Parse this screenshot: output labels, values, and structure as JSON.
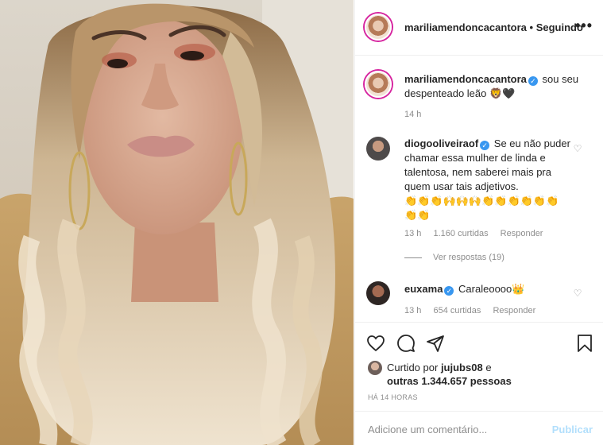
{
  "header": {
    "username": "mariliamendoncacantora",
    "separator": "•",
    "follow_state": "Seguindo",
    "more_icon": "ellipsis-icon",
    "more_label": "•••"
  },
  "caption": {
    "username": "mariliamendoncacantora",
    "text": "sou seu despenteado leão 🦁🖤",
    "time": "14 h"
  },
  "comments": [
    {
      "username": "diogooliveiraof",
      "text": "Se eu não puder chamar essa mulher de linda e talentosa, nem saberei mais pra quem usar tais adjetivos.",
      "emojis": "👏👏👏🙌🙌🙌👏👏👏👏👏👏👏👏",
      "time": "13 h",
      "likes": "1.160 curtidas",
      "reply": "Responder",
      "view_replies": "Ver respostas (19)"
    },
    {
      "username": "euxama",
      "text": "Caraleoooo👑",
      "time": "13 h",
      "likes": "654 curtidas",
      "reply": "Responder"
    }
  ],
  "actions": {
    "like_icon": "heart-icon",
    "comment_icon": "comment-icon",
    "share_icon": "send-icon",
    "save_icon": "bookmark-icon"
  },
  "likes_summary": {
    "prefix": "Curtido por",
    "user": "jujubs08",
    "mid": "e",
    "others": "outras 1.344.657 pessoas"
  },
  "post_age": "HÁ 14 HORAS",
  "comment_box": {
    "placeholder": "Adicione um comentário...",
    "publish": "Publicar"
  },
  "colors": {
    "verified": "#3897f0",
    "muted": "#8e8e8e",
    "publish_disabled": "#b2dffc",
    "story_ring": "#d6249f"
  }
}
